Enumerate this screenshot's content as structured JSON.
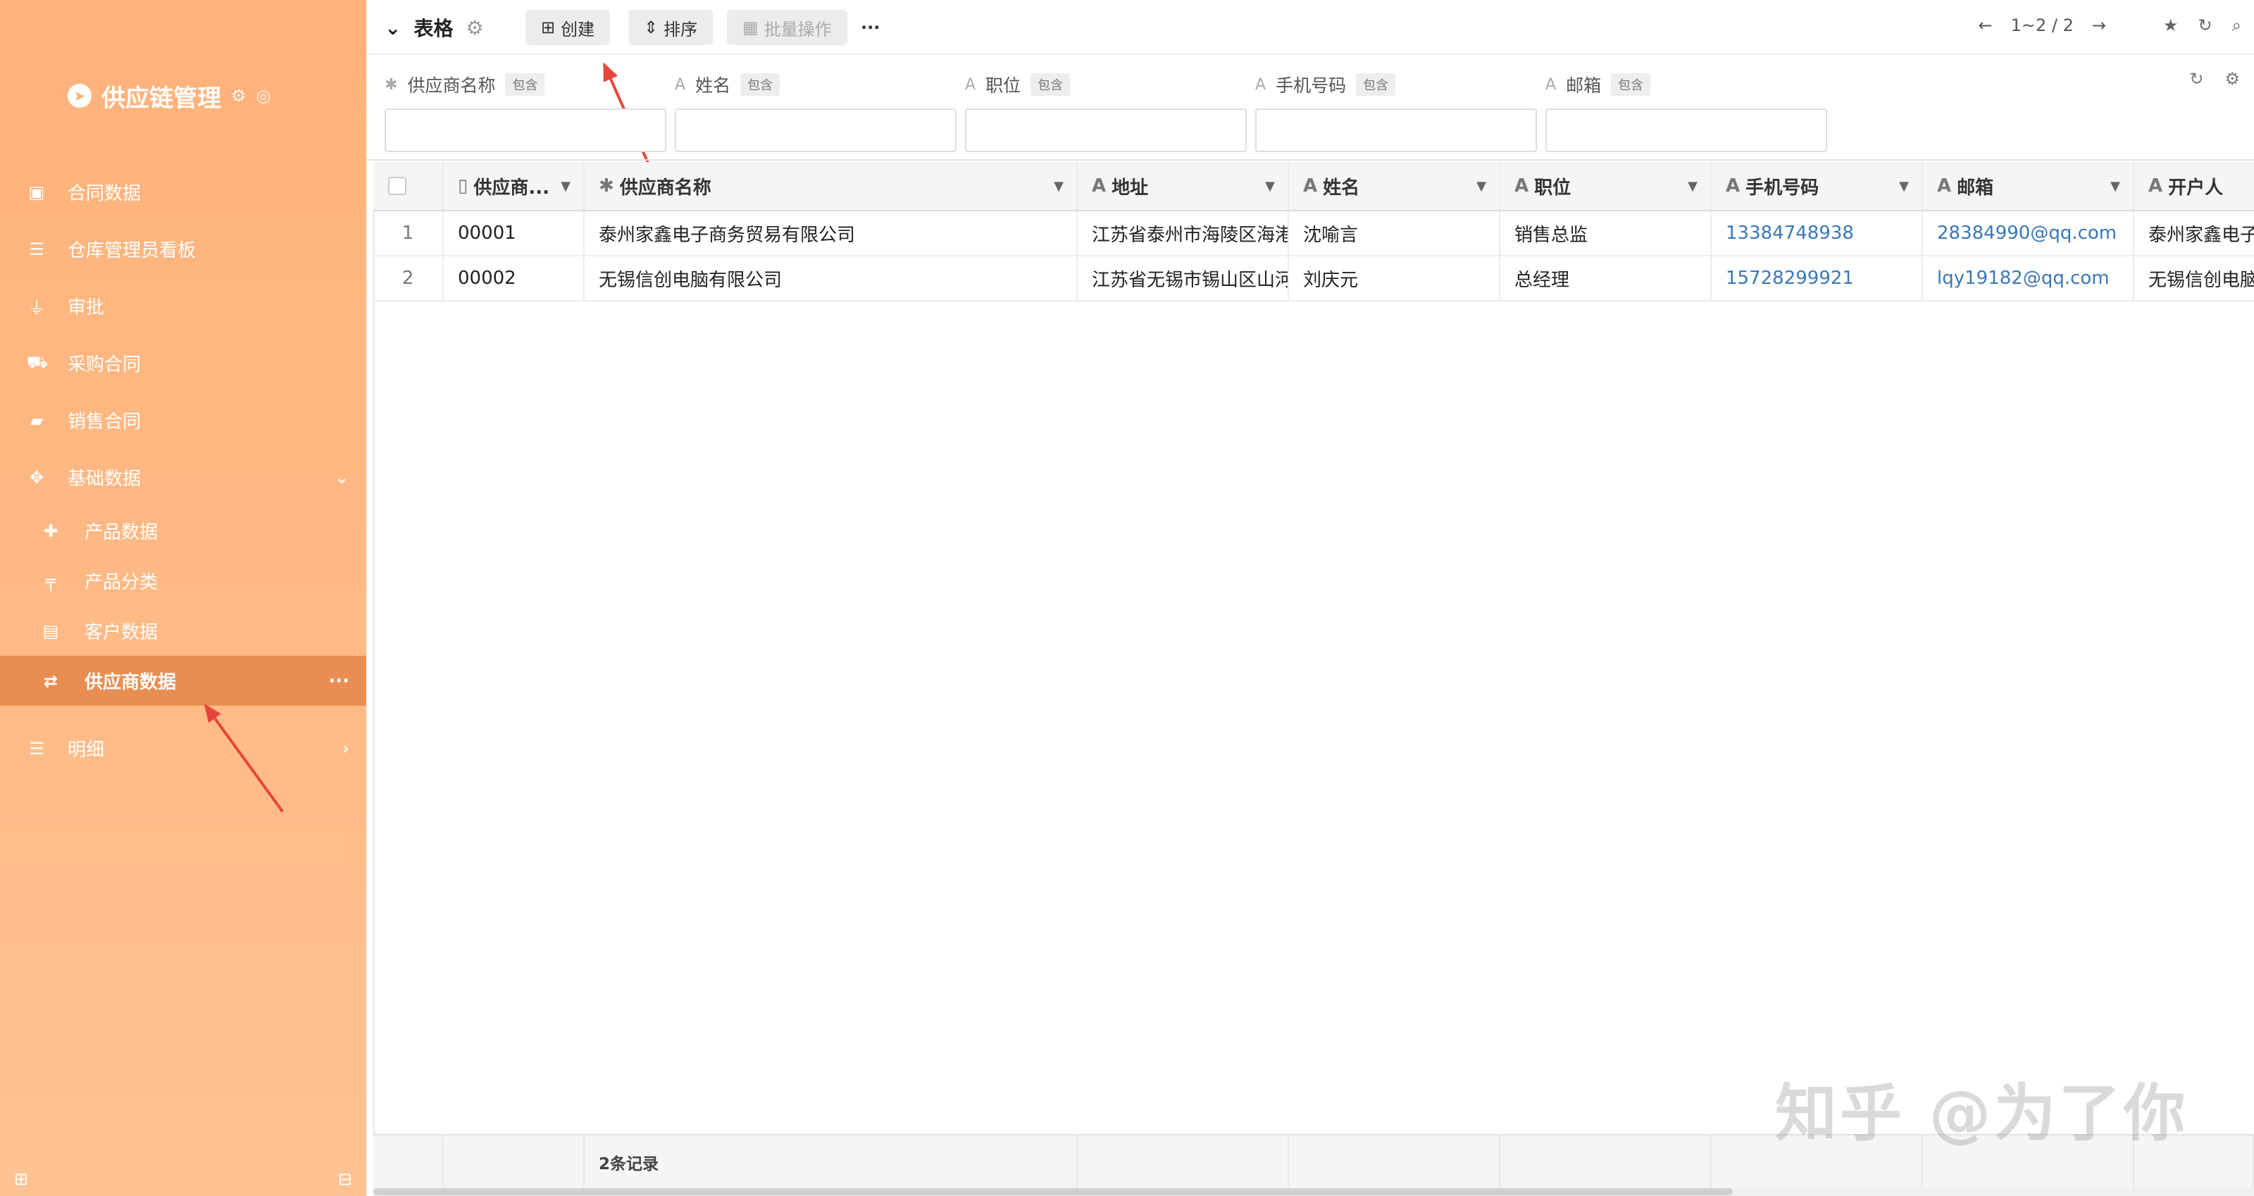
{
  "sidebar": {
    "brand": "供应链管理",
    "items": [
      {
        "label": "合同数据",
        "icon": "briefcase-icon"
      },
      {
        "label": "仓库管理员看板",
        "icon": "list-icon"
      },
      {
        "label": "审批",
        "icon": "stamp-icon"
      },
      {
        "label": "采购合同",
        "icon": "basket-icon"
      },
      {
        "label": "销售合同",
        "icon": "book-icon"
      },
      {
        "label": "基础数据",
        "icon": "crosshair-icon"
      }
    ],
    "sub_items": [
      {
        "label": "产品数据",
        "icon": "puzzle-icon"
      },
      {
        "label": "产品分类",
        "icon": "signpost-icon"
      },
      {
        "label": "客户数据",
        "icon": "id-card-icon"
      },
      {
        "label": "供应商数据",
        "icon": "retweet-icon"
      }
    ],
    "detail_item": {
      "label": "明细",
      "icon": "list-icon"
    }
  },
  "toolbar": {
    "title": "表格",
    "create_label": "创建",
    "sort_label": "排序",
    "batch_label": "批量操作",
    "more_label": "···",
    "pager_text": "1~2 / 2"
  },
  "filters": [
    {
      "label": "供应商名称",
      "tag": "包含",
      "type": "✱"
    },
    {
      "label": "姓名",
      "tag": "包含",
      "type": "A"
    },
    {
      "label": "职位",
      "tag": "包含",
      "type": "A"
    },
    {
      "label": "手机号码",
      "tag": "包含",
      "type": "A"
    },
    {
      "label": "邮箱",
      "tag": "包含",
      "type": "A"
    }
  ],
  "table": {
    "columns": [
      "供应商...",
      "供应商名称",
      "地址",
      "姓名",
      "职位",
      "手机号码",
      "邮箱",
      "开户人"
    ],
    "rows": [
      {
        "idx": "1",
        "code": "00001",
        "name": "泰州家鑫电子商务贸易有限公司",
        "address": "江苏省泰州市海陵区海港",
        "person": "沈喻言",
        "position": "销售总监",
        "phone": "13384748938",
        "email": "28384990@qq.com",
        "holder": "泰州家鑫电子"
      },
      {
        "idx": "2",
        "code": "00002",
        "name": "无锡信创电脑有限公司",
        "address": "江苏省无锡市锡山区山河",
        "person": "刘庆元",
        "position": "总经理",
        "phone": "15728299921",
        "email": "lqy19182@qq.com",
        "holder": "无锡信创电脑"
      }
    ],
    "footer": "2条记录"
  },
  "watermark": "知乎 @为了你",
  "colors": {
    "sidebar": "#ffb27a",
    "active": "#e98e52",
    "link": "#3a78b7",
    "arrow": "#e8453a"
  }
}
